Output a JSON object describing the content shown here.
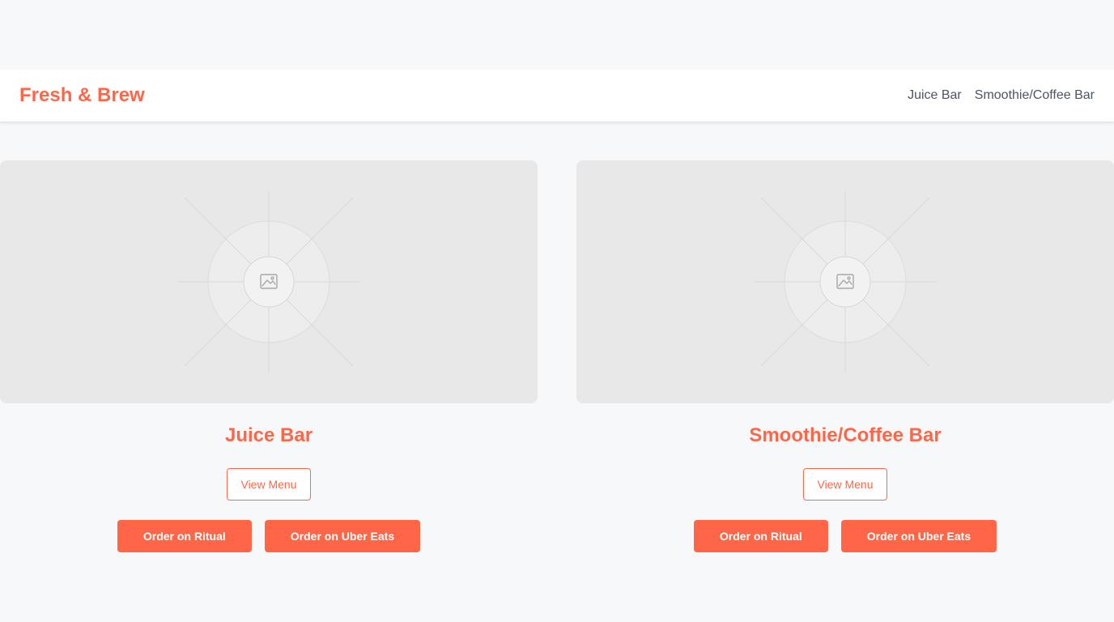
{
  "brand": {
    "name": "Fresh & Brew"
  },
  "nav": {
    "links": [
      {
        "label": "Juice Bar"
      },
      {
        "label": "Smoothie/Coffee Bar"
      }
    ]
  },
  "venues": [
    {
      "title": "Juice Bar",
      "image_icon": "image-placeholder-icon",
      "view_menu_label": "View Menu",
      "order_ritual_label": "Order on Ritual",
      "order_ubereats_label": "Order on Uber Eats"
    },
    {
      "title": "Smoothie/Coffee Bar",
      "image_icon": "image-placeholder-icon",
      "view_menu_label": "View Menu",
      "order_ritual_label": "Order on Ritual",
      "order_ubereats_label": "Order on Uber Eats"
    }
  ],
  "colors": {
    "accent": "#ff6647",
    "background": "#f7f8fa",
    "navbar": "#ffffff",
    "nav_text": "#4b5563",
    "image_placeholder": "#e8e8e8"
  }
}
